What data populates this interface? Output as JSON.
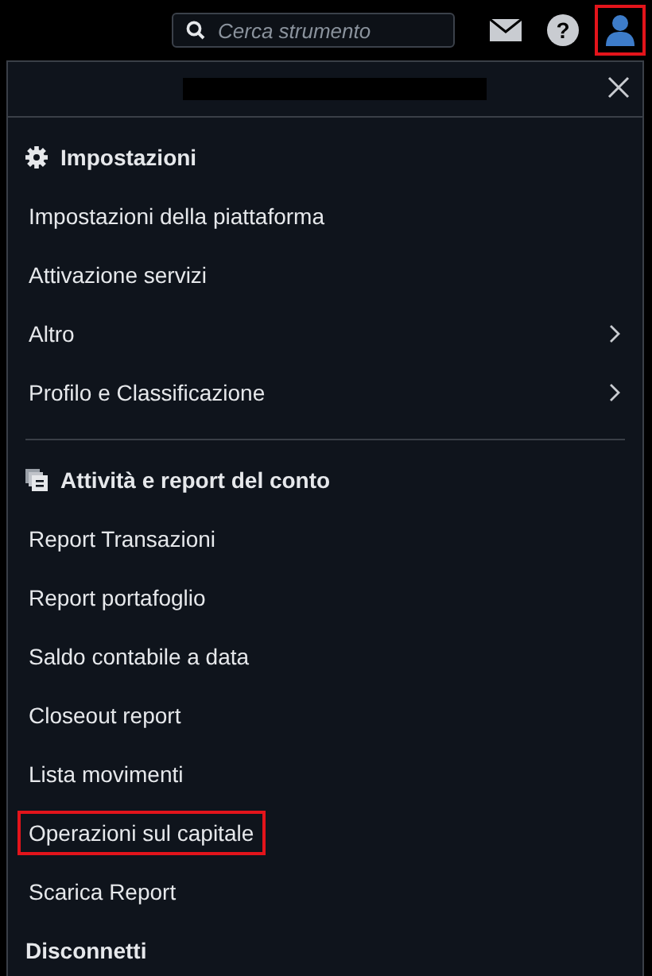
{
  "search": {
    "placeholder": "Cerca strumento"
  },
  "toolbar": [
    {
      "kind": "mail",
      "highlighted": false
    },
    {
      "kind": "help",
      "highlighted": false,
      "glyph": "?"
    },
    {
      "kind": "user",
      "highlighted": true
    }
  ],
  "sections": [
    {
      "kind": "settings",
      "title": "Impostazioni",
      "items": [
        {
          "label": "Impostazioni della piattaforma",
          "submenu": false,
          "highlighted": false
        },
        {
          "label": "Attivazione servizi",
          "submenu": false,
          "highlighted": false
        },
        {
          "label": "Altro",
          "submenu": true,
          "highlighted": false
        },
        {
          "label": "Profilo e Classificazione",
          "submenu": true,
          "highlighted": false
        }
      ]
    },
    {
      "kind": "reports",
      "title": "Attività e report del conto",
      "items": [
        {
          "label": "Report Transazioni",
          "submenu": false,
          "highlighted": false
        },
        {
          "label": "Report portafoglio",
          "submenu": false,
          "highlighted": false
        },
        {
          "label": "Saldo contabile a data",
          "submenu": false,
          "highlighted": false
        },
        {
          "label": "Closeout report",
          "submenu": false,
          "highlighted": false
        },
        {
          "label": "Lista movimenti",
          "submenu": false,
          "highlighted": false
        },
        {
          "label": "Operazioni sul capitale",
          "submenu": false,
          "highlighted": true
        },
        {
          "label": "Scarica Report",
          "submenu": false,
          "highlighted": false
        }
      ]
    }
  ],
  "logout": {
    "label": "Disconnetti"
  }
}
